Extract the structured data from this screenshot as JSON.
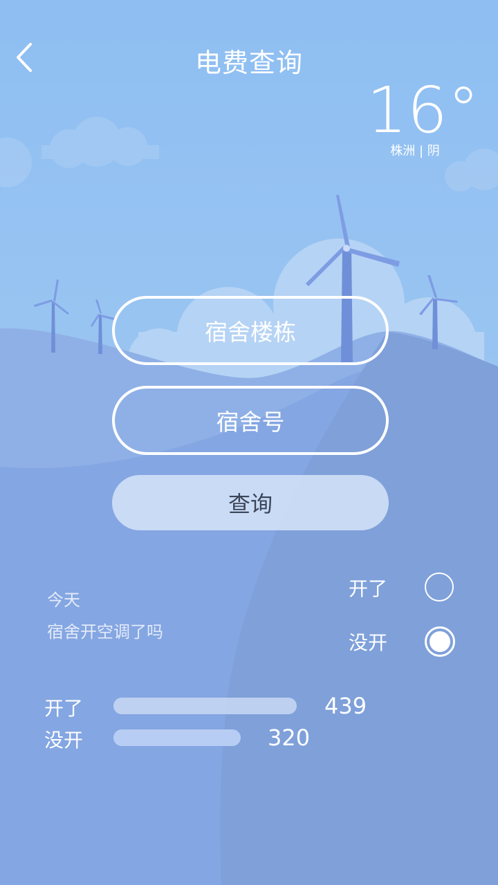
{
  "header": {
    "title": "电费查询"
  },
  "weather": {
    "temperature": "16°",
    "location": "株洲 | 阴"
  },
  "form": {
    "building_label": "宿舍楼栋",
    "room_label": "宿舍号",
    "query_label": "查询"
  },
  "poll": {
    "line1": "今天",
    "line2": "宿舍开空调了吗",
    "options": [
      {
        "label": "开了",
        "selected": false
      },
      {
        "label": "没开",
        "selected": true
      }
    ]
  },
  "stats": [
    {
      "label": "开了",
      "value": "439"
    },
    {
      "label": "没开",
      "value": "320"
    }
  ],
  "colors": {
    "sky_top": "#8cbcf0",
    "hill": "#7f9fd8",
    "white": "#ffffff"
  }
}
